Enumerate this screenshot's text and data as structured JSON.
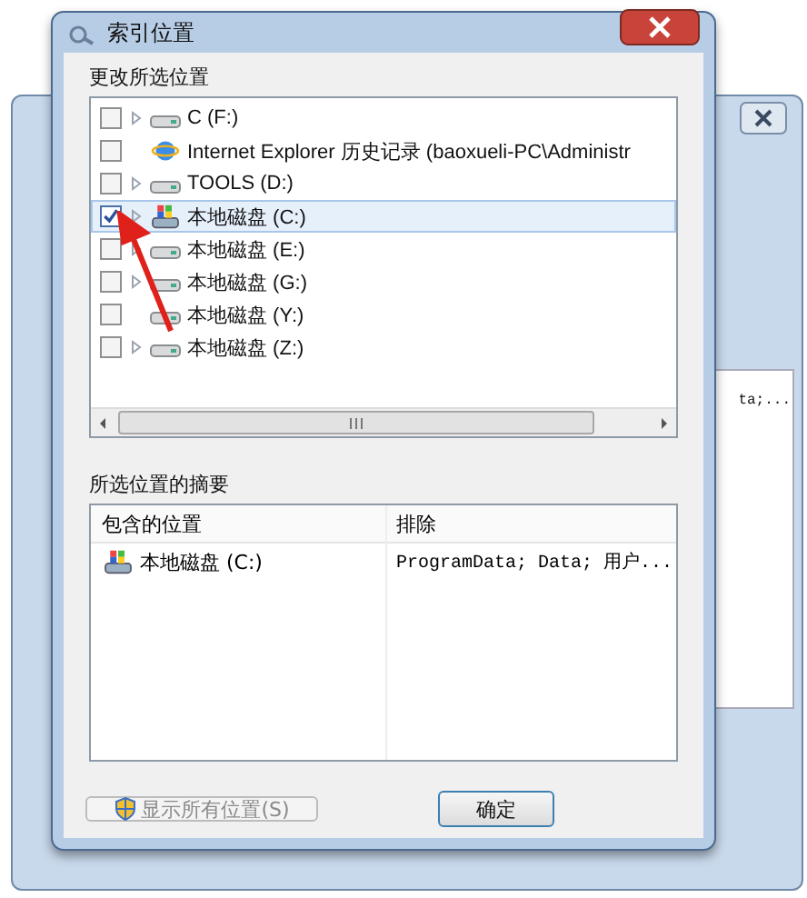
{
  "background_window": {
    "cell_text": "ta;..."
  },
  "dialog": {
    "title": "索引位置",
    "locations_group": {
      "label": "更改所选位置",
      "items": [
        {
          "label": "C (F:)",
          "kind": "drive",
          "checked": false,
          "expandable": true,
          "selected": false
        },
        {
          "label": "Internet Explorer 历史记录 (baoxueli-PC\\Administr",
          "kind": "browser",
          "checked": false,
          "expandable": false,
          "selected": false
        },
        {
          "label": "TOOLS (D:)",
          "kind": "drive",
          "checked": false,
          "expandable": true,
          "selected": false
        },
        {
          "label": "本地磁盘 (C:)",
          "kind": "system",
          "checked": true,
          "expandable": true,
          "selected": true
        },
        {
          "label": "本地磁盘 (E:)",
          "kind": "drive",
          "checked": false,
          "expandable": true,
          "selected": false
        },
        {
          "label": "本地磁盘 (G:)",
          "kind": "drive",
          "checked": false,
          "expandable": true,
          "selected": false
        },
        {
          "label": "本地磁盘 (Y:)",
          "kind": "drive",
          "checked": false,
          "expandable": false,
          "selected": false
        },
        {
          "label": "本地磁盘 (Z:)",
          "kind": "drive",
          "checked": false,
          "expandable": true,
          "selected": false
        }
      ]
    },
    "summary_group": {
      "label": "所选位置的摘要",
      "columns": [
        "包含的位置",
        "排除"
      ],
      "rows": [
        {
          "location": "本地磁盘 (C:)",
          "kind": "system",
          "excluded": "ProgramData; Data; 用户..."
        }
      ]
    },
    "buttons": [
      {
        "label": "显示所有位置(S)",
        "disabled": true,
        "kind": "shield"
      },
      {
        "label": "确定",
        "disabled": false,
        "kind": "plain"
      }
    ]
  }
}
